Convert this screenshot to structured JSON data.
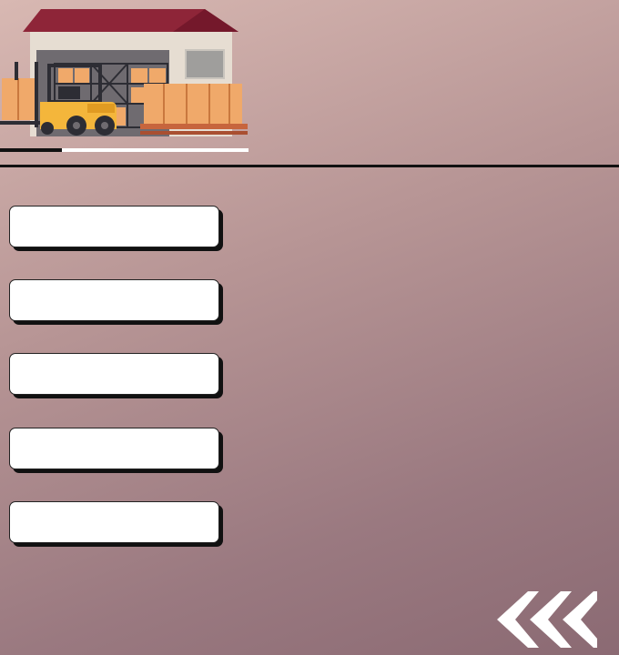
{
  "illustration": {
    "name": "warehouse-forklift-illustration",
    "colors": {
      "roof": "#8e2538",
      "wall": "#e6ddd2",
      "box": "#f0a96a",
      "forklift": "#f4b63b",
      "dark": "#2d2d34"
    }
  },
  "progress": {
    "value_percent": 25
  },
  "menu": {
    "buttons": [
      {
        "label": ""
      },
      {
        "label": ""
      },
      {
        "label": ""
      },
      {
        "label": ""
      },
      {
        "label": ""
      }
    ]
  },
  "back_button": {
    "icon": "triple-chevron-left-icon",
    "color": "#ffffff"
  }
}
